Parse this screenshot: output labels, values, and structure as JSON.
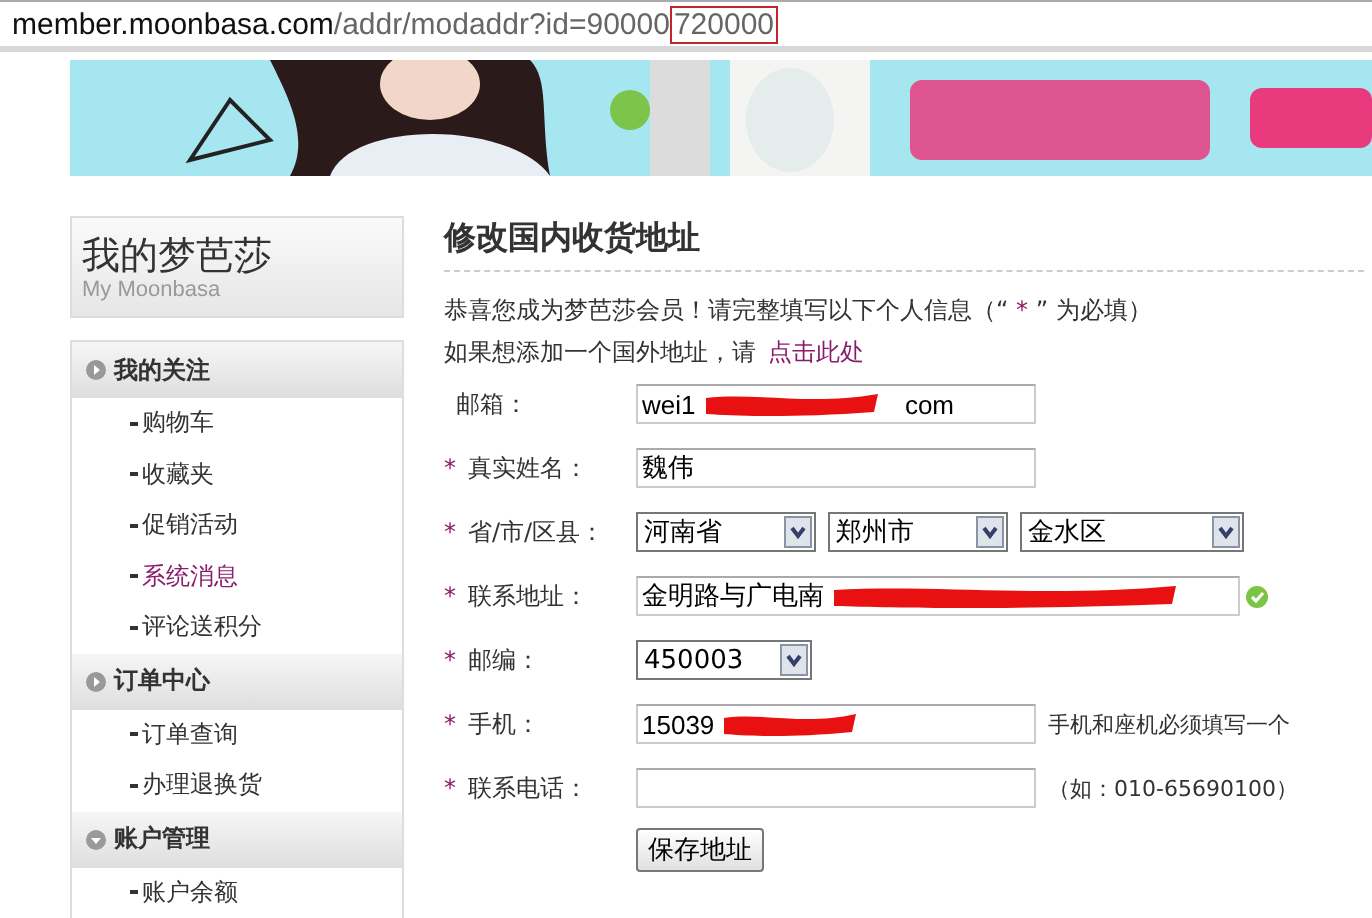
{
  "address_bar": {
    "host": "member.moonbasa.com",
    "path": "/addr/modaddr?id=90000",
    "highlighted": "720000"
  },
  "sidebar": {
    "title": "我的梦芭莎",
    "subtitle": "My Moonbasa",
    "sections": [
      {
        "title": "我的关注",
        "items": [
          {
            "label": "购物车",
            "selected": false
          },
          {
            "label": "收藏夹",
            "selected": false
          },
          {
            "label": "促销活动",
            "selected": false
          },
          {
            "label": "系统消息",
            "selected": true
          },
          {
            "label": "评论送积分",
            "selected": false
          }
        ]
      },
      {
        "title": "订单中心",
        "items": [
          {
            "label": "订单查询",
            "selected": false
          },
          {
            "label": "办理退换货",
            "selected": false
          }
        ]
      },
      {
        "title": "账户管理",
        "items": [
          {
            "label": "账户余额",
            "selected": false
          }
        ]
      }
    ]
  },
  "main": {
    "title": "修改国内收货地址",
    "intro_before": "恭喜您成为梦芭莎会员！请完整填写以下个人信息（“",
    "intro_mark": "*",
    "intro_after": "” 为必填）",
    "foreign_text": "如果想添加一个国外地址，请",
    "foreign_link": "点击此处",
    "fields": [
      {
        "kind": "text",
        "label": "邮箱：",
        "required": false,
        "value": "wei1",
        "value_tail": "com",
        "redacted": true
      },
      {
        "kind": "text",
        "label": "真实姓名：",
        "required": true,
        "value": "魏伟",
        "redacted": false
      },
      {
        "kind": "selects",
        "label": "省/市/区县：",
        "required": true,
        "options": [
          "河南省",
          "郑州市",
          "金水区"
        ]
      },
      {
        "kind": "text",
        "label": "联系地址：",
        "required": true,
        "value": "金明路与广电南",
        "redacted": true,
        "valid": true
      },
      {
        "kind": "select",
        "label": "邮编：",
        "required": true,
        "options": [
          "450003"
        ]
      },
      {
        "kind": "text",
        "label": "手机：",
        "required": true,
        "value": "15039",
        "redacted": true,
        "note": "手机和座机必须填写一个"
      },
      {
        "kind": "text",
        "label": "联系电话：",
        "required": true,
        "redacted": false,
        "note": "（如：010-65690100）"
      }
    ],
    "save_button": "保存地址"
  }
}
